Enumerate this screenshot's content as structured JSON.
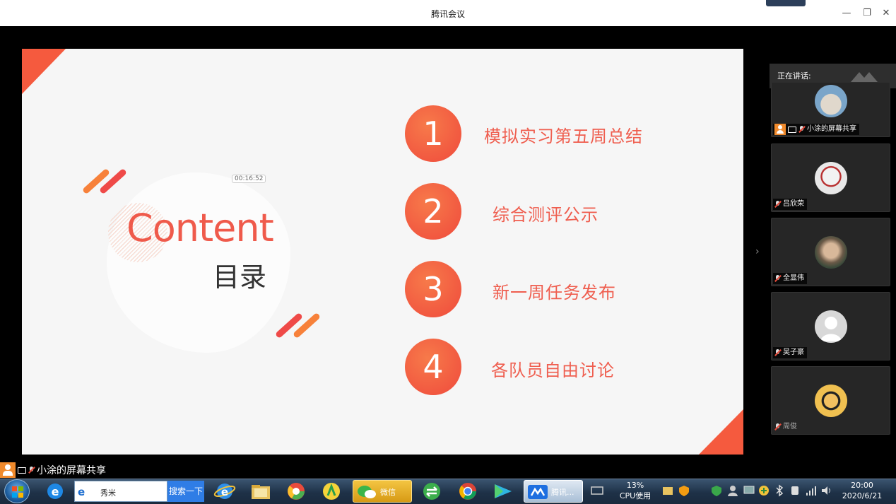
{
  "window": {
    "title": "腾讯会议"
  },
  "slide": {
    "heading_en": "Content",
    "heading_cn": "目录",
    "timer": "00:16:52",
    "items": [
      {
        "number": "1",
        "text": "模拟实习第五周总结"
      },
      {
        "number": "2",
        "text": "综合测评公示"
      },
      {
        "number": "3",
        "text": "新一周任务发布"
      },
      {
        "number": "4",
        "text": "各队员自由讨论"
      }
    ],
    "colors": {
      "accent": "#ef5a4b",
      "orange": "#f7813a"
    }
  },
  "panel": {
    "speaking_label": "正在讲话:",
    "participants": [
      {
        "name": "小涂的屏幕共享",
        "host": true
      },
      {
        "name": "吕欣荣"
      },
      {
        "name": "全显伟"
      },
      {
        "name": "吴子豪"
      },
      {
        "name": "周俊"
      }
    ]
  },
  "screen_share_label": "小涂的屏幕共享",
  "taskbar": {
    "search_text": "秀米",
    "search_button": "搜索一下",
    "wechat_label": "微信",
    "tencent_label": "腾讯...",
    "cpu_percent": "13%",
    "cpu_label": "CPU使用",
    "time": "20:00",
    "date": "2020/6/21"
  }
}
